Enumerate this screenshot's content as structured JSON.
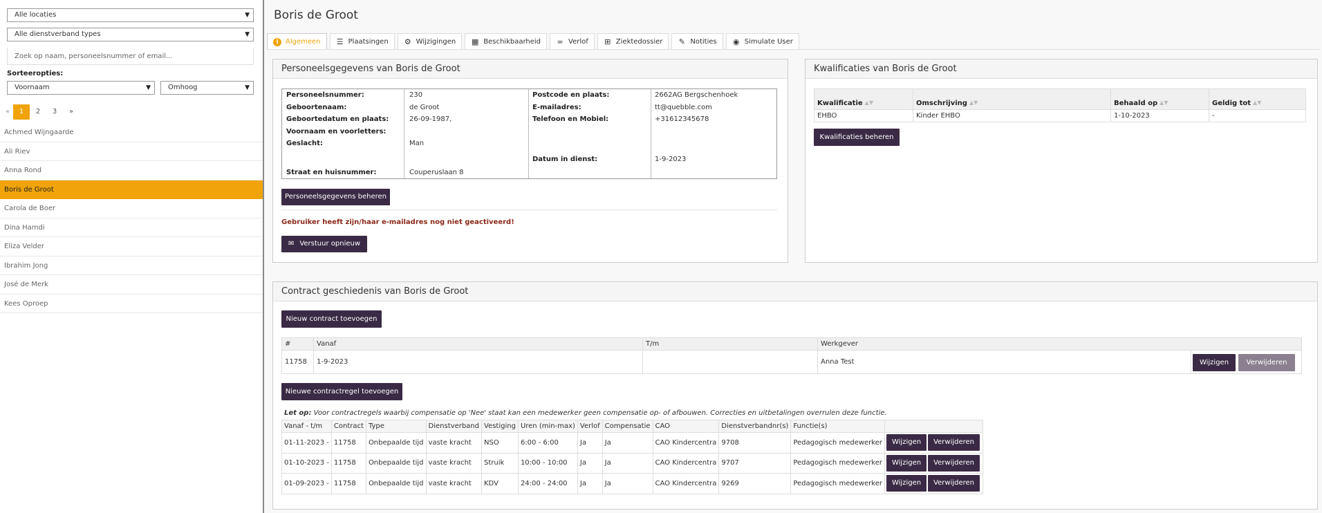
{
  "sidebar": {
    "location_filter": "Alle locaties",
    "employment_filter": "Alle dienstverband types",
    "search_placeholder": "Zoek op naam, personeelsnummer of email...",
    "sort_label": "Sorteeropties:",
    "sort_field": "Voornaam",
    "sort_direction": "Omhoog",
    "pager": {
      "first": "«",
      "pages": [
        "1",
        "2",
        "3"
      ],
      "next": "»",
      "active_page": "1"
    },
    "people": [
      "Achmed Wijngaarde",
      "Ali Riev",
      "Anna Rond",
      "Boris de Groot",
      "Carola de Boer",
      "Dina Hamdi",
      "Eliza Velder",
      "Ibrahim Jong",
      "José de Merk",
      "Kees Oproep"
    ],
    "selected_person": "Boris de Groot"
  },
  "header": {
    "title": "Boris de Groot"
  },
  "tabs": [
    {
      "label": "Algemeen",
      "icon": "info-icon",
      "active": true
    },
    {
      "label": "Plaatsingen",
      "icon": "list-icon"
    },
    {
      "label": "Wijzigingen",
      "icon": "gear-icon"
    },
    {
      "label": "Beschikbaarheid",
      "icon": "calendar-icon"
    },
    {
      "label": "Verlof",
      "icon": "sunglasses-icon"
    },
    {
      "label": "Ziektedossier",
      "icon": "medkit-icon"
    },
    {
      "label": "Notities",
      "icon": "edit-icon"
    },
    {
      "label": "Simulate User",
      "icon": "eye-icon"
    }
  ],
  "personnel": {
    "title": "Personeelsgegevens van Boris de Groot",
    "personeelsnummer_label": "Personeelsnummer:",
    "personeelsnummer": "230",
    "geboortenaam_label": "Geboortenaam:",
    "geboortenaam": "de Groot",
    "geboortedatum_label": "Geboortedatum en plaats:",
    "geboortedatum": "26-09-1987,",
    "voornaam_label": "Voornaam en voorletters:",
    "geslacht_label": "Geslacht:",
    "geslacht": "Man",
    "straat_label": "Straat en huisnummer:",
    "straat": "Couperuslaan 8",
    "postcode_label": "Postcode en plaats:",
    "postcode": "2662AG Bergschenhoek",
    "email_label": "E-mailadres:",
    "email": "tt@quebble.com",
    "telefoon_label": "Telefoon en Mobiel:",
    "telefoon": "+31612345678",
    "indienst_label": "Datum in dienst:",
    "indienst": "1-9-2023",
    "manage_button": "Personeelsgegevens beheren",
    "warning": "Gebruiker heeft zijn/haar e-mailadres nog niet geactiveerd!",
    "resend_button": "Verstuur opnieuw"
  },
  "qualifications": {
    "title": "Kwalificaties van Boris de Groot",
    "columns": [
      "Kwalificatie",
      "Omschrijving",
      "Behaald op",
      "Geldig tot"
    ],
    "rows": [
      [
        "EHBO",
        "Kinder EHBO",
        "1-10-2023",
        "-"
      ]
    ],
    "manage_button": "Kwalificaties beheren"
  },
  "contracts": {
    "title": "Contract geschiedenis van Boris de Groot",
    "add_contract_button": "Nieuw contract toevoegen",
    "columns": [
      "#",
      "Vanaf",
      "T/m",
      "Werkgever"
    ],
    "rows": [
      {
        "id": "11758",
        "vanaf": "1-9-2023",
        "tm": "",
        "werkgever": "Anna Test"
      }
    ],
    "edit_label": "Wijzigen",
    "delete_label": "Verwijderen",
    "add_rule_button": "Nieuwe contractregel toevoegen",
    "note_prefix": "Let op:",
    "note": " Voor contractregels waarbij compensatie op 'Nee' staat kan een medewerker geen compensatie op- of afbouwen. Correcties en uitbetalingen overrulen deze functie.",
    "rule_columns": [
      "Vanaf - t/m",
      "Contract",
      "Type",
      "Dienstverband",
      "Vestiging",
      "Uren (min-max)",
      "Verlof",
      "Compensatie",
      "CAO",
      "Dienstverbandnr(s)",
      "Functie(s)"
    ],
    "rules": [
      [
        "01-11-2023 -",
        "11758",
        "Onbepaalde tijd",
        "vaste kracht",
        "NSO",
        "6:00 - 6:00",
        "Ja",
        "Ja",
        "CAO Kindercentra",
        "9708",
        "Pedagogisch medewerker"
      ],
      [
        "01-10-2023 -",
        "11758",
        "Onbepaalde tijd",
        "vaste kracht",
        "Struik",
        "10:00 - 10:00",
        "Ja",
        "Ja",
        "CAO Kindercentra",
        "9707",
        "Pedagogisch medewerker"
      ],
      [
        "01-09-2023 -",
        "11758",
        "Onbepaalde tijd",
        "vaste kracht",
        "KDV",
        "24:00 - 24:00",
        "Ja",
        "Ja",
        "CAO Kindercentra",
        "9269",
        "Pedagogisch medewerker"
      ]
    ]
  },
  "colors": {
    "accent": "#f0a30a",
    "button": "#3b2a45",
    "warning": "#8b2a1a"
  }
}
